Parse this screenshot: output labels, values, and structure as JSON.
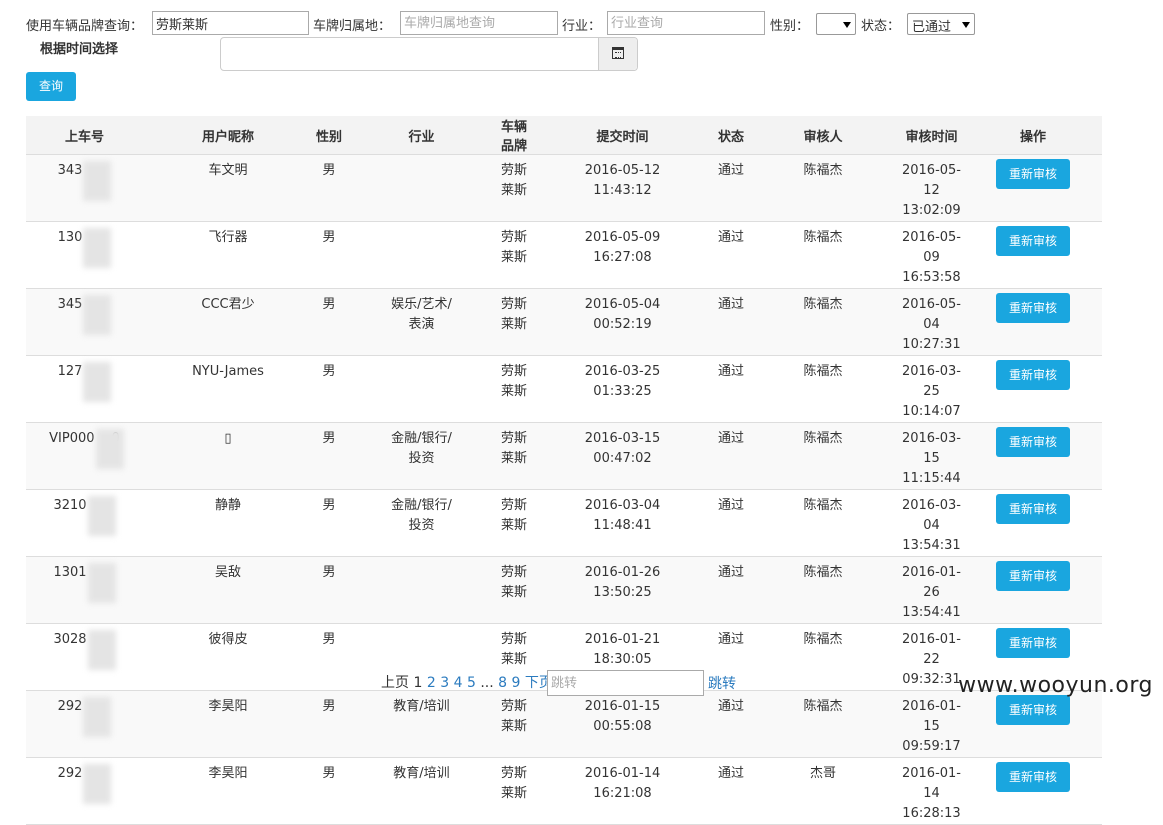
{
  "filters": {
    "brand_label": "使用车辆品牌查询：",
    "brand_value": "劳斯莱斯",
    "plate_label": "车牌归属地：",
    "plate_placeholder": "车牌归属地查询",
    "industry_label": "行业：",
    "industry_placeholder": "行业查询",
    "gender_label": "性别：",
    "gender_value": "",
    "status_label": "状态：",
    "status_value": "已通过",
    "time_label": "根据时间选择",
    "query_button": "查询"
  },
  "table": {
    "headers": [
      "上车号",
      "用户昵称",
      "性别",
      "行业",
      "车辆品牌",
      "提交时间",
      "状态",
      "审核人",
      "审核时间",
      "操作"
    ],
    "rows": [
      {
        "id": "343",
        "nick": "车文明",
        "gender": "男",
        "industry1": "",
        "industry2": "",
        "brand": "劳斯莱斯",
        "submit_date": "2016-05-12",
        "submit_time": "11:43:12",
        "status": "通过",
        "reviewer": "陈福杰",
        "review_date": "2016-05-12",
        "review_time": "13:02:09",
        "action": "重新审核"
      },
      {
        "id": "130",
        "nick": "飞行器",
        "gender": "男",
        "industry1": "",
        "industry2": "",
        "brand": "劳斯莱斯",
        "submit_date": "2016-05-09",
        "submit_time": "16:27:08",
        "status": "通过",
        "reviewer": "陈福杰",
        "review_date": "2016-05-09",
        "review_time": "16:53:58",
        "action": "重新审核"
      },
      {
        "id": "345",
        "nick": "CCC君少",
        "gender": "男",
        "industry1": "娱乐/艺术/",
        "industry2": "表演",
        "brand": "劳斯莱斯",
        "submit_date": "2016-05-04",
        "submit_time": "00:52:19",
        "status": "通过",
        "reviewer": "陈福杰",
        "review_date": "2016-05-04",
        "review_time": "10:27:31",
        "action": "重新审核"
      },
      {
        "id": "127",
        "nick": "NYU-James",
        "gender": "男",
        "industry1": "",
        "industry2": "",
        "brand": "劳斯莱斯",
        "submit_date": "2016-03-25",
        "submit_time": "01:33:25",
        "status": "通过",
        "reviewer": "陈福杰",
        "review_date": "2016-03-25",
        "review_time": "10:14:07",
        "action": "重新审核"
      },
      {
        "id": "VIP000",
        "id_suffix": "0",
        "nick": "▯",
        "gender": "男",
        "industry1": "金融/银行/",
        "industry2": "投资",
        "brand": "劳斯莱斯",
        "submit_date": "2016-03-15",
        "submit_time": "00:47:02",
        "status": "通过",
        "reviewer": "陈福杰",
        "review_date": "2016-03-15",
        "review_time": "11:15:44",
        "action": "重新审核"
      },
      {
        "id": "3210",
        "nick": "静静",
        "gender": "男",
        "industry1": "金融/银行/",
        "industry2": "投资",
        "brand": "劳斯莱斯",
        "submit_date": "2016-03-04",
        "submit_time": "11:48:41",
        "status": "通过",
        "reviewer": "陈福杰",
        "review_date": "2016-03-04",
        "review_time": "13:54:31",
        "action": "重新审核"
      },
      {
        "id": "1301",
        "nick": "吴敌",
        "gender": "男",
        "industry1": "",
        "industry2": "",
        "brand": "劳斯莱斯",
        "submit_date": "2016-01-26",
        "submit_time": "13:50:25",
        "status": "通过",
        "reviewer": "陈福杰",
        "review_date": "2016-01-26",
        "review_time": "13:54:41",
        "action": "重新审核"
      },
      {
        "id": "3028",
        "nick": "彼得皮",
        "gender": "男",
        "industry1": "",
        "industry2": "",
        "brand": "劳斯莱斯",
        "submit_date": "2016-01-21",
        "submit_time": "18:30:05",
        "status": "通过",
        "reviewer": "陈福杰",
        "review_date": "2016-01-22",
        "review_time": "09:32:31",
        "action": "重新审核"
      },
      {
        "id": "292",
        "nick": "李昊阳",
        "gender": "男",
        "industry1": "教育/培训",
        "industry2": "",
        "brand": "劳斯莱斯",
        "submit_date": "2016-01-15",
        "submit_time": "00:55:08",
        "status": "通过",
        "reviewer": "陈福杰",
        "review_date": "2016-01-15",
        "review_time": "09:59:17",
        "action": "重新审核"
      },
      {
        "id": "292",
        "nick": "李昊阳",
        "gender": "男",
        "industry1": "教育/培训",
        "industry2": "",
        "brand": "劳斯莱斯",
        "submit_date": "2016-01-14",
        "submit_time": "16:21:08",
        "status": "通过",
        "reviewer": "杰哥",
        "review_date": "2016-01-14",
        "review_time": "16:28:13",
        "action": "重新审核"
      }
    ]
  },
  "pagination": {
    "prev": "上页",
    "current": "1",
    "pages": [
      "2",
      "3",
      "4",
      "5"
    ],
    "ellipsis": "...",
    "tail_pages": [
      "8",
      "9"
    ],
    "next": "下页",
    "jump_placeholder": "跳转",
    "jump_label": "跳转"
  },
  "watermark": "www.wooyun.org",
  "colors": {
    "accent": "#1aa6df",
    "link": "#2b7bbf"
  }
}
